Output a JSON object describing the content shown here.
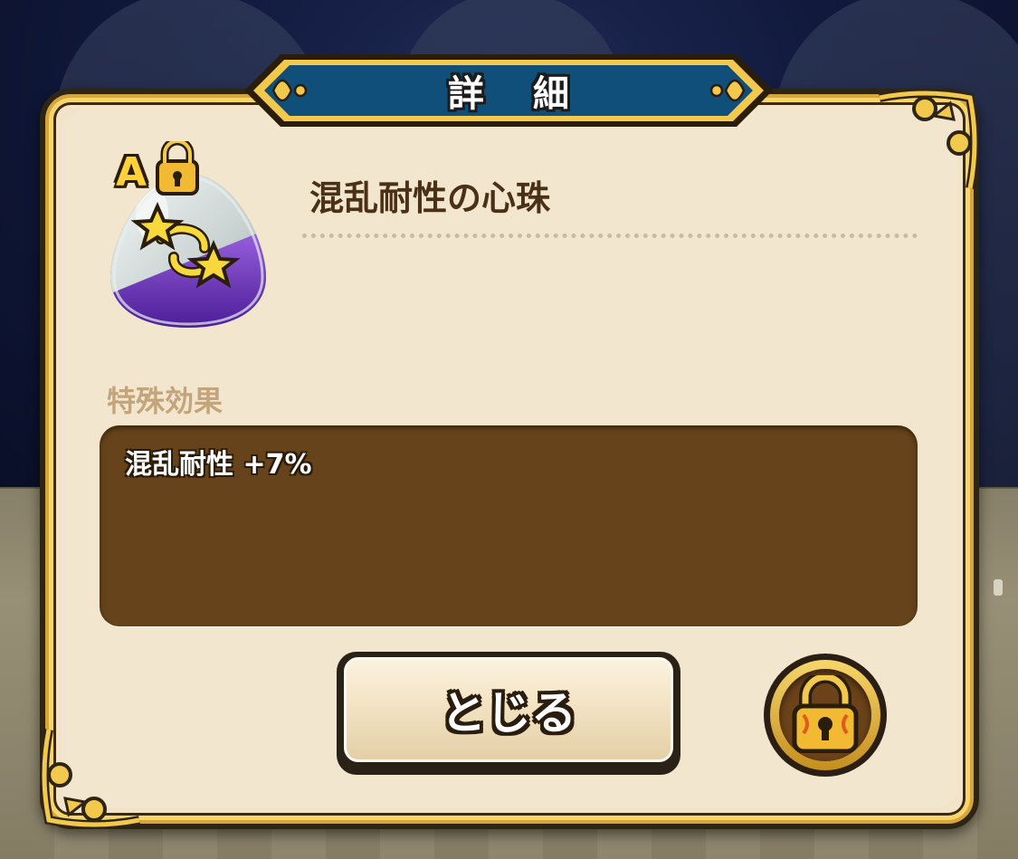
{
  "dialog": {
    "title": "詳細",
    "item": {
      "name": "混乱耐性の心珠",
      "rank": "A",
      "icon": "purple-silver-egg-orb-with-stars-icon",
      "locked": true
    },
    "effects_section_label": "特殊効果",
    "effects": [
      "混乱耐性 +7%"
    ],
    "close_button_label": "とじる",
    "lock_button_icon": "lock-icon"
  },
  "colors": {
    "panel_bg": "#f2e3c9",
    "gold_border": "#d6a63a",
    "banner_blue": "#0f4f7a",
    "effect_box": "#66431a",
    "item_name_text": "#4a3016",
    "section_label_text": "#c3a47b"
  }
}
